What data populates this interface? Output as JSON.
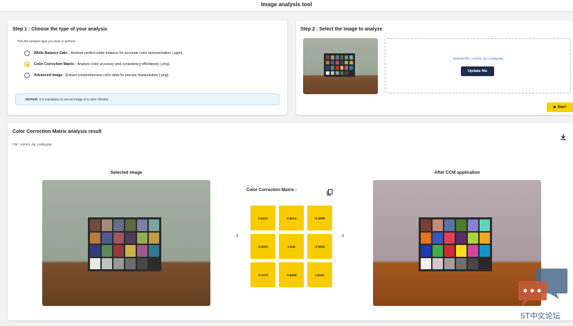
{
  "app": {
    "title": "Image analysis tool"
  },
  "step1": {
    "title": "Step 1 : Choose the type of your analysis",
    "prompt": "Pick the analysis type you want to perform :",
    "options": [
      {
        "name": "White Balance Gain :",
        "desc": "Achieve perfect white balance for accurate color representation (.pgm).",
        "selected": false
      },
      {
        "name": "Color Correction Matrix :",
        "desc": "Analyze color accuracy and consistency effortlessly (.png).",
        "selected": true
      },
      {
        "name": "Advanced Image :",
        "desc": "Extract comprehensive color data for precise manipulation (.png).",
        "selected": false
      }
    ],
    "notice_label": "NOTICE:",
    "notice_text": "It is mandatory to use an image of a color checker."
  },
  "step2": {
    "title": "Step 2 : Select the image to analyze",
    "selected_file_text": "Selected file: current_isp_config.png",
    "update_label": "Update file",
    "start_label": "Start"
  },
  "result": {
    "title": "Color Correction Matrix analysis result",
    "file_label": "File : current_isp_config.png",
    "selected_label": "Selected image",
    "after_label": "After CCM application",
    "matrix_title": "Color Correction Matrix :",
    "matrix": [
      [
        "2.5414",
        "-0.8114",
        "-0.4655"
      ],
      [
        "-0.5321",
        "1.645",
        "-0.5832"
      ],
      [
        "-0.2372",
        "-0.5426",
        "1.8161"
      ]
    ]
  },
  "watermark": {
    "text": "ST中文论坛"
  },
  "icons": {
    "download": "download-icon",
    "copy": "copy-icon",
    "play": "play-icon",
    "prev": "chevron-left-icon",
    "next": "chevron-right-icon"
  },
  "colors": {
    "accent": "#f9cc00",
    "dark_button": "#1f2b4d"
  }
}
